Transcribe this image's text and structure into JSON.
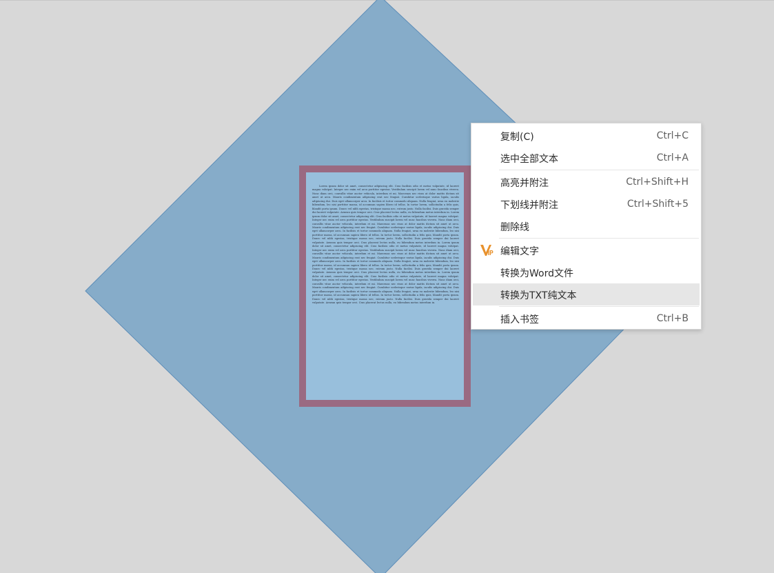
{
  "colors": {
    "background": "#d8d8d8",
    "diamond_fill": "#86acc9",
    "diamond_stroke": "#5d8db8",
    "page_frame": "#9a6a82",
    "page_fill": "#98bfdc",
    "menu_hover": "#e6e6e6",
    "vip_orange": "#e8922e"
  },
  "document": {
    "body_text": "Lorem ipsum dolor sit amet, consectetur adipiscing elit. Cras facilisis odio et metus vulputate, id laoreet magna volutpat. Integer nec enim vel arcu porttitor egestas. Vestibulum suscipit lorem vel nunc faucibus viverra. Nunc diam orci, convallis vitae auctor vehicula, interdum et mi. Maecenas nec risus at dolor mattis dictum sit amet ut arcu. Mauris condimentum adipiscing erat nec feugiat. Curabitur scelerisque varius ligula, iaculis adipiscing dui. Duis eget ullamcorper arcu. In facilisis et tortor commodo aliquam. Nulla feugiat, urna eu molestie bibendum, leo nisi porttitor massa, id accumsan sapien libero id tellus. In tortor lorem, sollicitudin a felis quis, blandit porta ipsum. Donec vel nibh egestas, tristique massa nec, rutrum justo. Nulla facilisi. Duis gravida semper dui laoreet vulputate. Aenean quis tempor orci. Cras placerat lectus nulla, eu bibendum metus interdum in. Lorem ipsum dolor sit amet, consectetur adipiscing elit. Cras facilisis odio et metus vulputate, id laoreet magna volutpat. Integer nec enim vel arcu porttitor egestas. Vestibulum suscipit lorem vel nunc faucibus viverra. Nunc diam orci, convallis vitae auctor vehicula, interdum et mi. Maecenas nec risus at dolor mattis dictum sit amet ut arcu. Mauris condimentum adipiscing erat nec feugiat. Curabitur scelerisque varius ligula, iaculis adipiscing dui. Duis eget ullamcorper arcu. In facilisis et tortor commodo aliquam. Nulla feugiat, urna eu molestie bibendum, leo nisi porttitor massa, id accumsan sapien libero id tellus. In tortor lorem, sollicitudin a felis quis, blandit porta ipsum. Donec vel nibh egestas, tristique massa nec, rutrum justo. Nulla facilisi. Duis gravida semper dui laoreet vulputate. Aenean quis tempor orci. Cras placerat lectus nulla, eu bibendum metus interdum in. Lorem ipsum dolor sit amet, consectetur adipiscing elit. Cras facilisis odio et metus vulputate, id laoreet magna volutpat. Integer nec enim vel arcu porttitor egestas. Vestibulum suscipit lorem vel nunc faucibus viverra. Nunc diam orci, convallis vitae auctor vehicula, interdum et mi. Maecenas nec risus at dolor mattis dictum sit amet ut arcu. Mauris condimentum adipiscing erat nec feugiat. Curabitur scelerisque varius ligula, iaculis adipiscing dui. Duis eget ullamcorper arcu. In facilisis et tortor commodo aliquam. Nulla feugiat, urna eu molestie bibendum, leo nisi porttitor massa, id accumsan sapien libero id tellus. In tortor lorem, sollicitudin a felis quis, blandit porta ipsum. Donec vel nibh egestas, tristique massa nec, rutrum justo. Nulla facilisi. Duis gravida semper dui laoreet vulputate. Aenean quis tempor orci. Cras placerat lectus nulla, eu bibendum metus interdum in. Lorem ipsum dolor sit amet, consectetur adipiscing elit. Cras facilisis odio et metus vulputate, id laoreet magna volutpat. Integer nec enim vel arcu porttitor egestas. Vestibulum suscipit lorem vel nunc faucibus viverra. Nunc diam orci, convallis vitae auctor vehicula, interdum et mi. Maecenas nec risus at dolor mattis dictum sit amet ut arcu. Mauris condimentum adipiscing erat nec feugiat. Curabitur scelerisque varius ligula, iaculis adipiscing dui. Duis eget ullamcorper arcu. In facilisis et tortor commodo aliquam. Nulla feugiat, urna eu molestie bibendum, leo nisi porttitor massa, id accumsan sapien libero id tellus. In tortor lorem, sollicitudin a felis quis, blandit porta ipsum. Donec vel nibh egestas, tristique massa nec, rutrum justo. Nulla facilisi. Duis gravida semper dui laoreet vulputate. Aenean quis tempor orci. Cras placerat lectus nulla, eu bibendum metus interdum in."
  },
  "context_menu": {
    "items": [
      {
        "label": "复制(C)",
        "shortcut": "Ctrl+C"
      },
      {
        "label": "选中全部文本",
        "shortcut": "Ctrl+A"
      },
      {
        "label": "高亮并附注",
        "shortcut": "Ctrl+Shift+H"
      },
      {
        "label": "下划线并附注",
        "shortcut": "Ctrl+Shift+5"
      },
      {
        "label": "删除线",
        "shortcut": ""
      },
      {
        "label": "编辑文字",
        "shortcut": "",
        "icon": "vip-icon"
      },
      {
        "label": "转换为Word文件",
        "shortcut": ""
      },
      {
        "label": "转换为TXT纯文本",
        "shortcut": "",
        "highlighted": true
      },
      {
        "label": "插入书签",
        "shortcut": "Ctrl+B"
      }
    ]
  }
}
